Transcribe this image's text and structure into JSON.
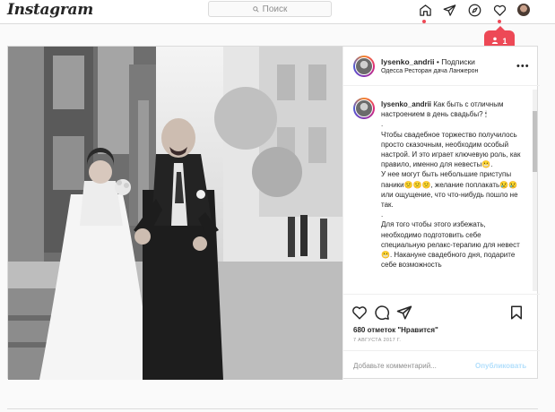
{
  "nav": {
    "logo": "Instagram",
    "search_placeholder": "Поиск",
    "icons": [
      "home-icon",
      "direct-icon",
      "explore-icon",
      "activity-icon",
      "profile-avatar"
    ]
  },
  "notification": {
    "count": "1",
    "icon": "person-icon",
    "color": "#ed4956"
  },
  "post": {
    "username": "lysenko_andrii",
    "follow_text": "• Подписки",
    "location": "Одесса Ресторан дача Ланжерон",
    "caption_user": "lysenko_andrii",
    "caption_text": "Как быть с отличным настроением в день свадьбы? 🕯\n.\nЧтобы свадебное торжество получилось просто сказочным, необходим особый настрой. И это играет ключевую роль, как правило, именно для невесты😬.\nУ нее могут быть небольшие приступы паники😕😕😕, желание поплакать😢😢 или ощущение, что что-нибудь пошло не так.\n.\nДля того чтобы этого избежать, необходимо подготовить себе специальную релакс-терапию для невест😬. Накануне свадебного дня, подарите себе возможность",
    "likes": "680 отметок \"Нравится\"",
    "date": "7 АВГУСТА 2017 Г.",
    "comment_placeholder": "Добавьте комментарий...",
    "publish_label": "Опубликовать"
  }
}
